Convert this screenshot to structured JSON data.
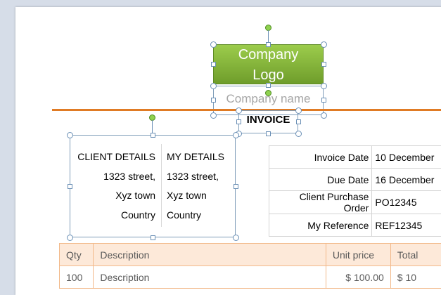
{
  "logo": {
    "label_line1": "Company",
    "label_line2": "Logo"
  },
  "company_name_placeholder": "Company name",
  "invoice_title": "INVOICE",
  "client_details": {
    "heading": "CLIENT DETAILS",
    "street": "1323 street,",
    "town": "Xyz town",
    "country": "Country"
  },
  "my_details": {
    "heading": "MY DETAILS",
    "street": "1323 street,",
    "town": "Xyz town",
    "country": "Country"
  },
  "info_rows": [
    {
      "label": "Invoice Date",
      "value": "10 December"
    },
    {
      "label": "Due Date",
      "value": "16 December"
    },
    {
      "label": "Client Purchase Order",
      "value": "PO12345"
    },
    {
      "label": "My Reference",
      "value": "REF12345"
    }
  ],
  "items_table": {
    "headers": {
      "qty": "Qty",
      "description": "Description",
      "unit_price": "Unit price",
      "total": "Total"
    },
    "rows": [
      {
        "qty": "100",
        "description": "Description",
        "unit_price": "$ 100.00",
        "total": "$ 10"
      }
    ]
  },
  "colors": {
    "accent_rule": "#e07b24",
    "logo_green": "#7fb03a",
    "table_header_bg": "#fde9d9"
  }
}
